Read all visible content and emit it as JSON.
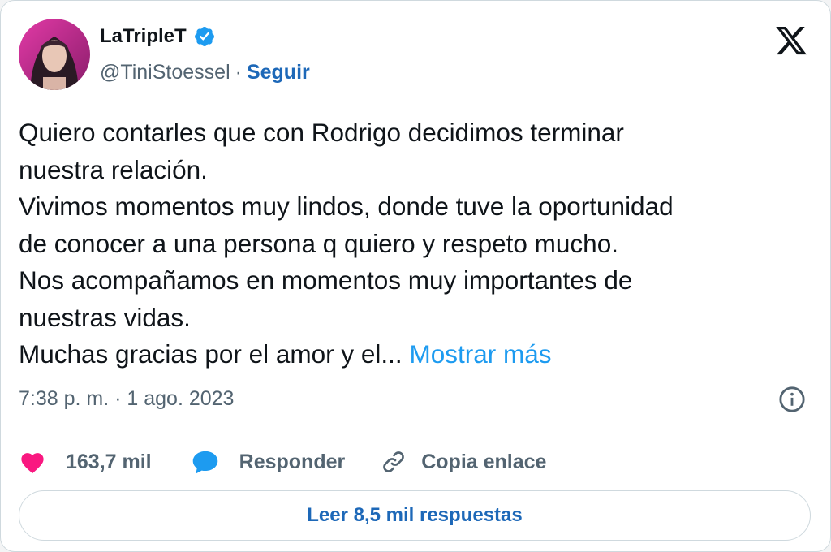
{
  "author": {
    "name": "LaTripleT",
    "handle": "@TiniStoessel",
    "separator": "·",
    "follow_label": "Seguir"
  },
  "tweet": {
    "lines": [
      "Quiero contarles que con Rodrigo decidimos terminar",
      "nuestra relación.",
      "Vivimos momentos muy lindos, donde tuve la oportunidad",
      "de conocer a una persona q quiero y respeto mucho.",
      "Nos acompañamos en momentos muy importantes de",
      "nuestras vidas.",
      "Muchas gracias por el amor y el..."
    ],
    "show_more_label": "Mostrar más",
    "timestamp": "7:38 p. m. · 1 ago. 2023"
  },
  "actions": {
    "likes": "163,7 mil",
    "reply_label": "Responder",
    "copy_label": "Copia enlace"
  },
  "read_replies_label": "Leer 8,5 mil respuestas",
  "colors": {
    "link": "#1d9bf0",
    "follow": "#1d68b8",
    "heart": "#f91880",
    "reply_bubble": "#1d9bf0",
    "verified": "#1d9bf0",
    "secondary_text": "#536471"
  },
  "icons": {
    "verified": "verified-badge-icon",
    "x_logo": "x-logo-icon",
    "info": "info-icon",
    "like": "heart-icon",
    "reply": "speech-bubble-icon",
    "copy": "link-icon"
  }
}
